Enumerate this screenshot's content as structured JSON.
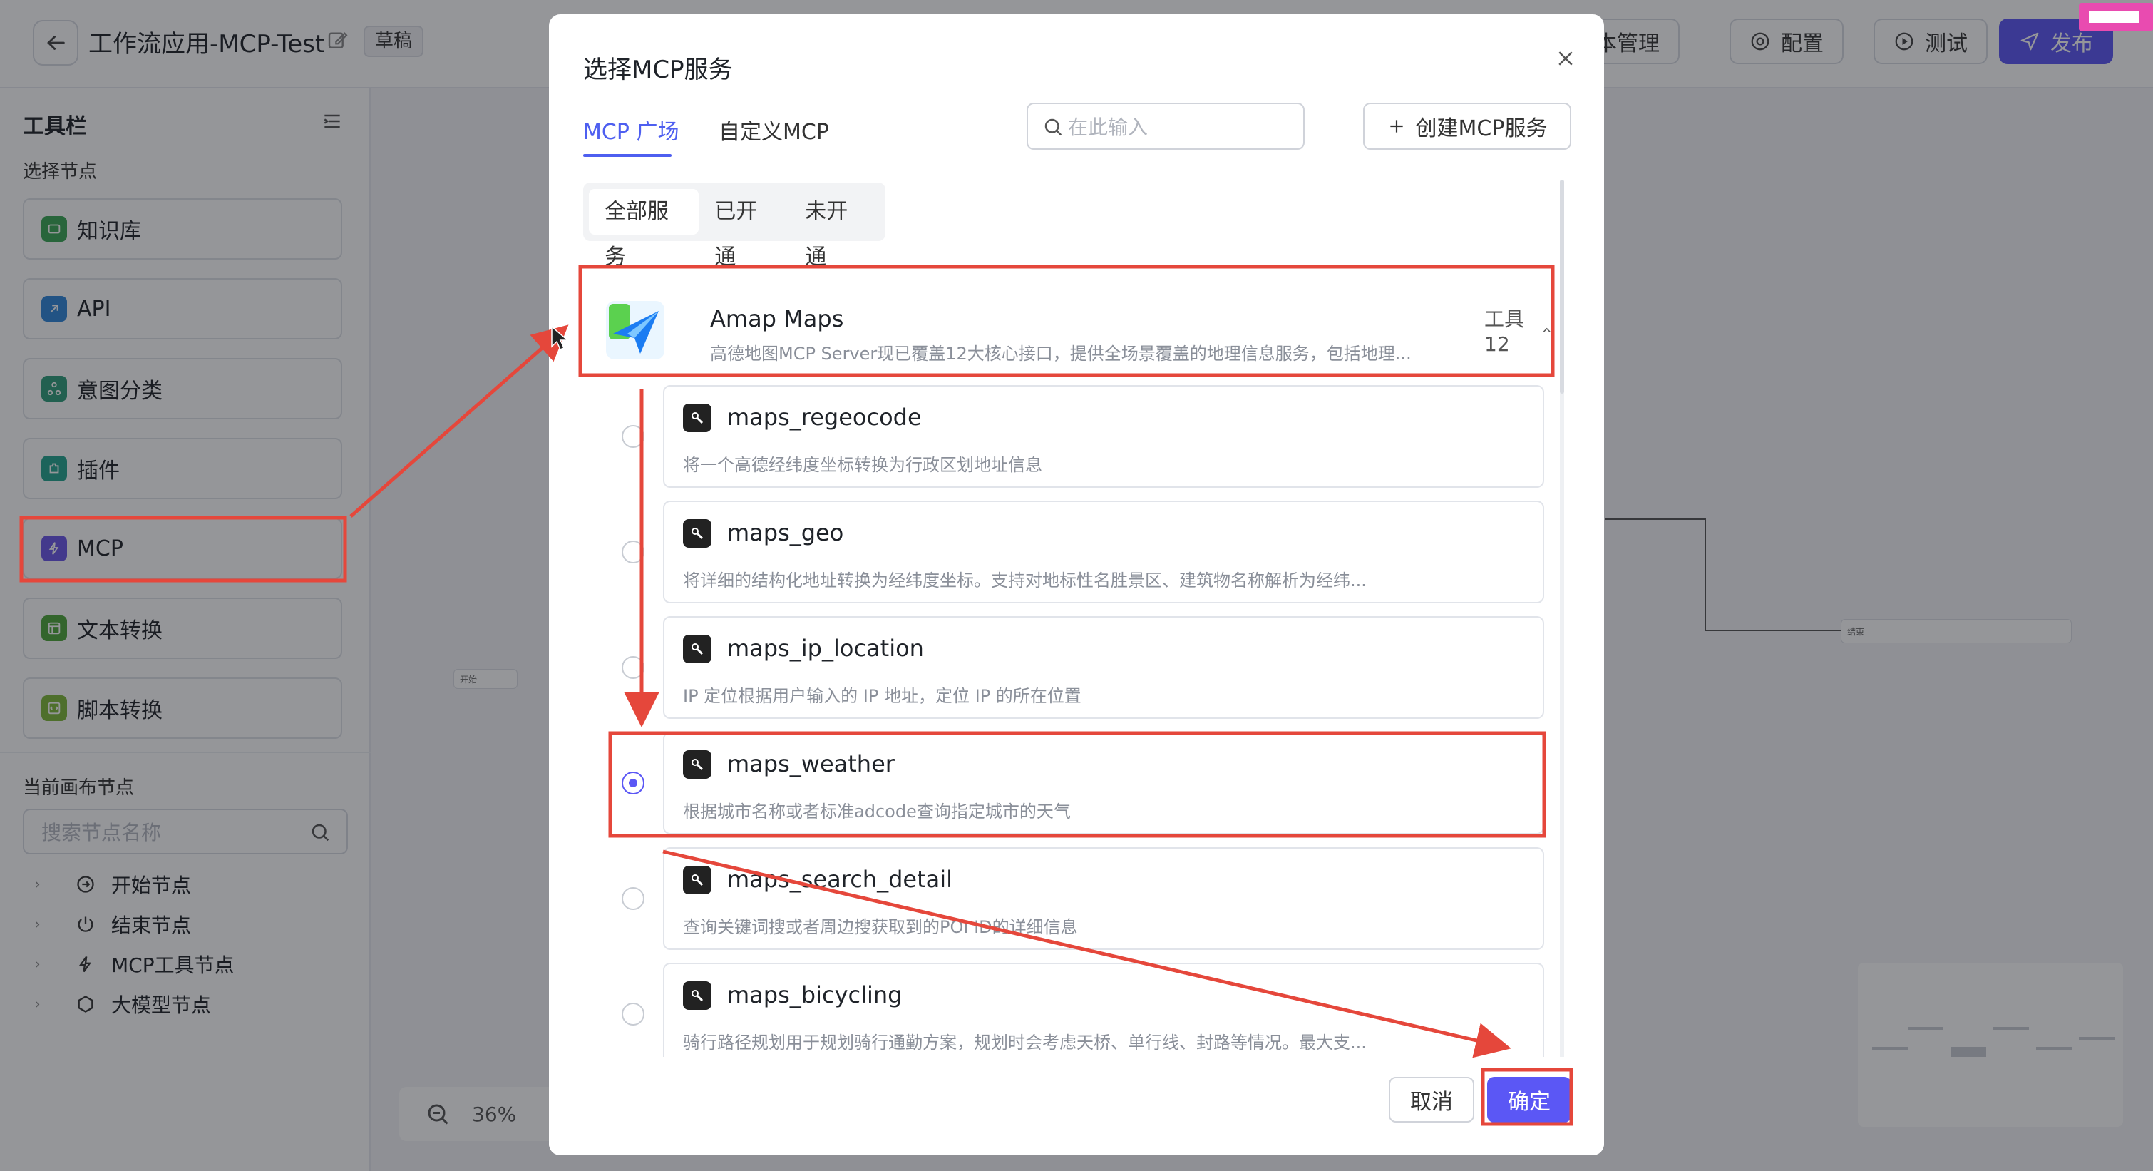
{
  "header": {
    "app_title": "工作流应用-MCP-Test",
    "draft_badge": "草稿",
    "version_label": "版本管理",
    "config_label": "配置",
    "test_label": "测试",
    "publish_label": "发布"
  },
  "sidebar": {
    "title": "工具栏",
    "select_nodes_label": "选择节点",
    "node_types": [
      {
        "label": "知识库",
        "icon": "knowledge-icon",
        "color": "#3aa655"
      },
      {
        "label": "API",
        "icon": "api-icon",
        "color": "#2f86d9"
      },
      {
        "label": "意图分类",
        "icon": "intent-icon",
        "color": "#2e9d7a"
      },
      {
        "label": "插件",
        "icon": "plugin-icon",
        "color": "#23a58f"
      },
      {
        "label": "MCP",
        "icon": "mcp-icon",
        "color": "#6b57e8"
      },
      {
        "label": "文本转换",
        "icon": "text-convert-icon",
        "color": "#4ea63a"
      },
      {
        "label": "脚本转换",
        "icon": "script-icon",
        "color": "#7fb83a"
      }
    ],
    "canvas_nodes_label": "当前画布节点",
    "search_placeholder": "搜索节点名称",
    "tree": [
      {
        "label": "开始节点",
        "icon": "start-node-icon"
      },
      {
        "label": "结束节点",
        "icon": "end-node-icon"
      },
      {
        "label": "MCP工具节点",
        "icon": "lightning-icon"
      },
      {
        "label": "大模型节点",
        "icon": "llm-icon"
      }
    ]
  },
  "canvas": {
    "zoom": "36%",
    "start_node_label": "开始",
    "end_node_label": "结束"
  },
  "modal": {
    "title": "选择MCP服务",
    "tabs": [
      "MCP 广场",
      "自定义MCP"
    ],
    "active_tab": "MCP 广场",
    "search_placeholder": "在此输入",
    "create_label": "创建MCP服务",
    "filters": [
      "全部服务",
      "已开通",
      "未开通"
    ],
    "active_filter": "全部服务",
    "service": {
      "name": "Amap Maps",
      "description": "高德地图MCP Server现已覆盖12大核心接口，提供全场景覆盖的地理信息服务，包括地理...",
      "tools_count": "工具12"
    },
    "tools": [
      {
        "name": "maps_regeocode",
        "desc": "将一个高德经纬度坐标转换为行政区划地址信息",
        "selected": false
      },
      {
        "name": "maps_geo",
        "desc": "将详细的结构化地址转换为经纬度坐标。支持对地标性名胜景区、建筑物名称解析为经纬...",
        "selected": false
      },
      {
        "name": "maps_ip_location",
        "desc": "IP 定位根据用户输入的 IP 地址，定位 IP 的所在位置",
        "selected": false
      },
      {
        "name": "maps_weather",
        "desc": "根据城市名称或者标准adcode查询指定城市的天气",
        "selected": true
      },
      {
        "name": "maps_search_detail",
        "desc": "查询关键词搜或者周边搜获取到的POI ID的详细信息",
        "selected": false
      },
      {
        "name": "maps_bicycling",
        "desc": "骑行路径规划用于规划骑行通勤方案，规划时会考虑天桥、单行线、封路等情况。最大支...",
        "selected": false
      }
    ],
    "cancel_label": "取消",
    "confirm_label": "确定"
  },
  "colors": {
    "accent": "#5b57f5",
    "tab_active": "#4e5ff0",
    "annotation": "#e5473b"
  }
}
